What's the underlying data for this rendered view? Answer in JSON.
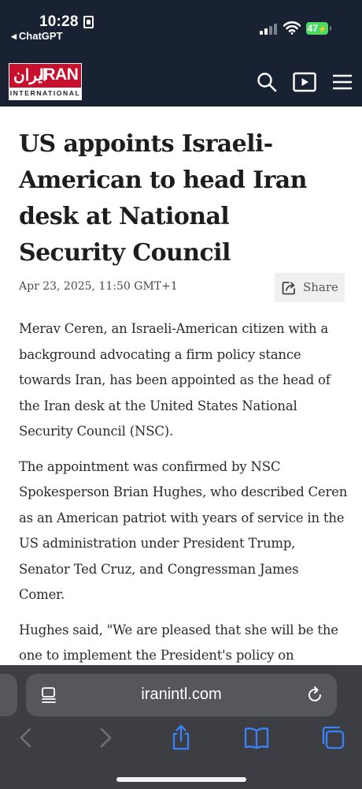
{
  "status_bar": {
    "time": "10:28",
    "back_app": "ChatGPT",
    "battery": "47",
    "icons": [
      "lock-icon",
      "signal-icon",
      "wifi-icon",
      "battery-icon"
    ]
  },
  "site": {
    "logo_persian": "ایران",
    "logo_english": "IRAN",
    "logo_sub": "INTERNATIONAL",
    "brand_color": "#c8102e",
    "header_color": "#182232",
    "nav_icons": [
      "search-icon",
      "video-icon",
      "menu-icon"
    ]
  },
  "article": {
    "headline": "US appoints Israeli-American to head Iran desk at National Security Council",
    "date": "Apr 23, 2025, 11:50 GMT+1",
    "share_label": "Share",
    "paragraphs": [
      "Merav Ceren, an Israeli-American citizen with a background advocating a firm policy stance towards Iran, has been appointed as the head of the Iran desk at the United States National Security Council (NSC).",
      "The appointment was confirmed by NSC Spokesperson Brian Hughes, who described Ceren as an American patriot with years of service in the US administration under President Trump, Senator Ted Cruz, and Congressman James Comer.",
      "Hughes said, \"We are pleased that she will be the one to implement the President's policy on"
    ]
  },
  "browser": {
    "url": "iranintl.com",
    "toolbar_icons": [
      "back-icon",
      "forward-icon",
      "share-icon",
      "bookmarks-icon",
      "tabs-icon"
    ],
    "bar_color": "#3d3e43",
    "accent": "#3a82f7"
  }
}
